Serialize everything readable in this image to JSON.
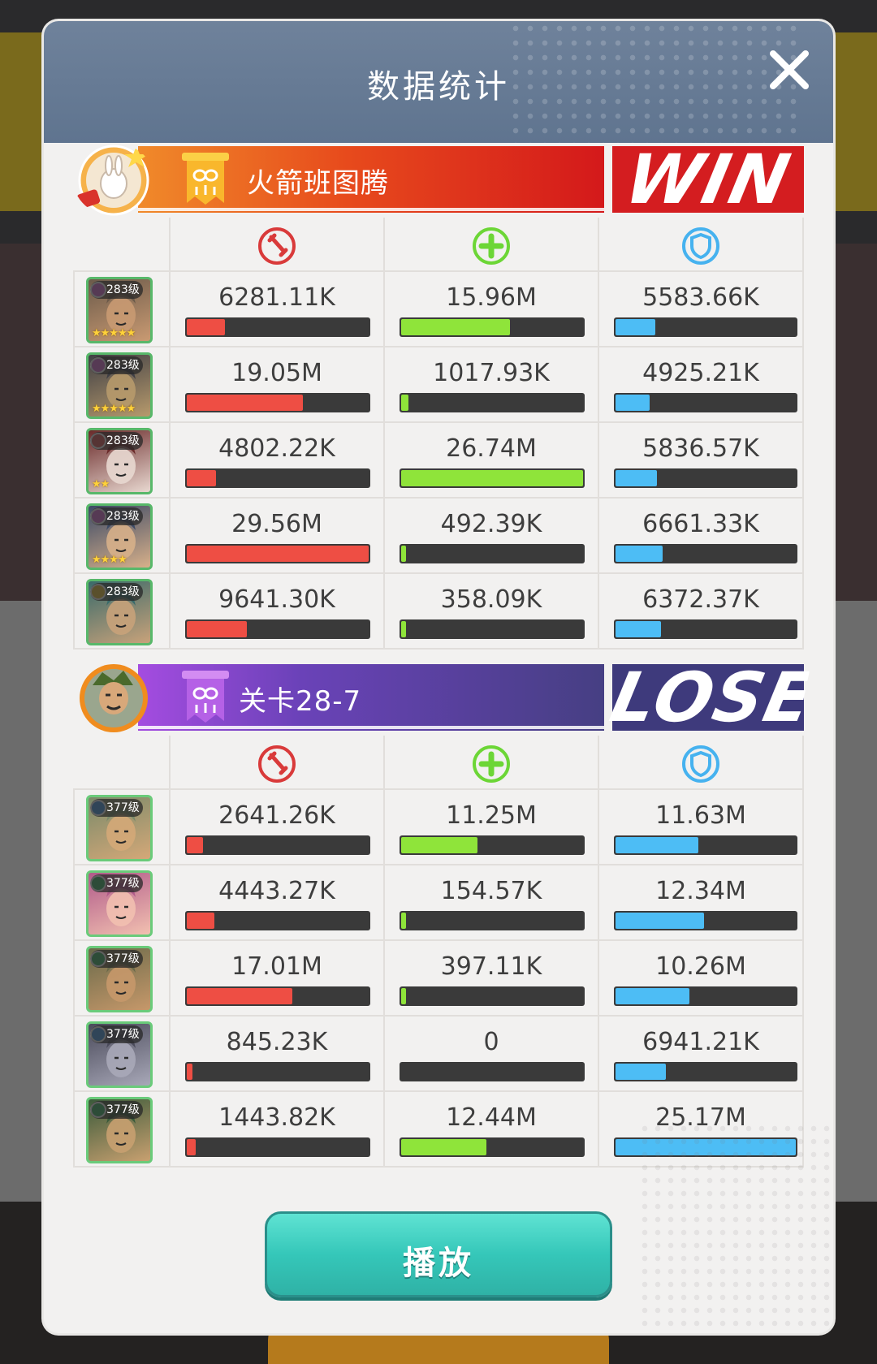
{
  "header": {
    "title": "数据统计"
  },
  "team1": {
    "name": "火箭班图腾",
    "result": "WIN",
    "heroes": [
      {
        "level": "283级",
        "stars": "★★★★★",
        "damage": "6281.11K",
        "heal": "15.96M",
        "shield": "5583.66K",
        "damage_pct": 21,
        "heal_pct": 60,
        "shield_pct": 22,
        "gem": "#e070d8"
      },
      {
        "level": "283级",
        "stars": "★★★★★",
        "damage": "19.05M",
        "heal": "1017.93K",
        "shield": "4925.21K",
        "damage_pct": 64,
        "heal_pct": 4,
        "shield_pct": 19,
        "gem": "#e070d8"
      },
      {
        "level": "283级",
        "stars": "★★",
        "damage": "4802.22K",
        "heal": "26.74M",
        "shield": "5836.57K",
        "damage_pct": 16,
        "heal_pct": 100,
        "shield_pct": 23,
        "gem": "#e05858"
      },
      {
        "level": "283级",
        "stars": "★★★★",
        "damage": "29.56M",
        "heal": "492.39K",
        "shield": "6661.33K",
        "damage_pct": 100,
        "heal_pct": 2,
        "shield_pct": 26,
        "gem": "#e070d8"
      },
      {
        "level": "283级",
        "stars": "",
        "damage": "9641.30K",
        "heal": "358.09K",
        "shield": "6372.37K",
        "damage_pct": 33,
        "heal_pct": 1,
        "shield_pct": 25,
        "gem": "#f0c838"
      }
    ]
  },
  "team2": {
    "name": "关卡28-7",
    "result": "LOSE",
    "heroes": [
      {
        "level": "377级",
        "stars": "",
        "damage": "2641.26K",
        "heal": "11.25M",
        "shield": "11.63M",
        "damage_pct": 9,
        "heal_pct": 42,
        "shield_pct": 46,
        "gem": "#4a9ae8"
      },
      {
        "level": "377级",
        "stars": "",
        "damage": "4443.27K",
        "heal": "154.57K",
        "shield": "12.34M",
        "damage_pct": 15,
        "heal_pct": 1,
        "shield_pct": 49,
        "gem": "#3fb86a"
      },
      {
        "level": "377级",
        "stars": "",
        "damage": "17.01M",
        "heal": "397.11K",
        "shield": "10.26M",
        "damage_pct": 58,
        "heal_pct": 2,
        "shield_pct": 41,
        "gem": "#3fb86a"
      },
      {
        "level": "377级",
        "stars": "",
        "damage": "845.23K",
        "heal": "0",
        "shield": "6941.21K",
        "damage_pct": 3,
        "heal_pct": 0,
        "shield_pct": 28,
        "gem": "#4a9ae8"
      },
      {
        "level": "377级",
        "stars": "",
        "damage": "1443.82K",
        "heal": "12.44M",
        "shield": "25.17M",
        "damage_pct": 5,
        "heal_pct": 47,
        "shield_pct": 100,
        "gem": "#3fb86a"
      }
    ]
  },
  "footer": {
    "play_label": "播放"
  },
  "colors": {
    "damage": "#ee4e44",
    "heal": "#8fe43a",
    "shield": "#4dbdf5"
  },
  "icons": {
    "damage": "sword-icon",
    "heal": "plus-icon",
    "shield": "shield-icon"
  }
}
